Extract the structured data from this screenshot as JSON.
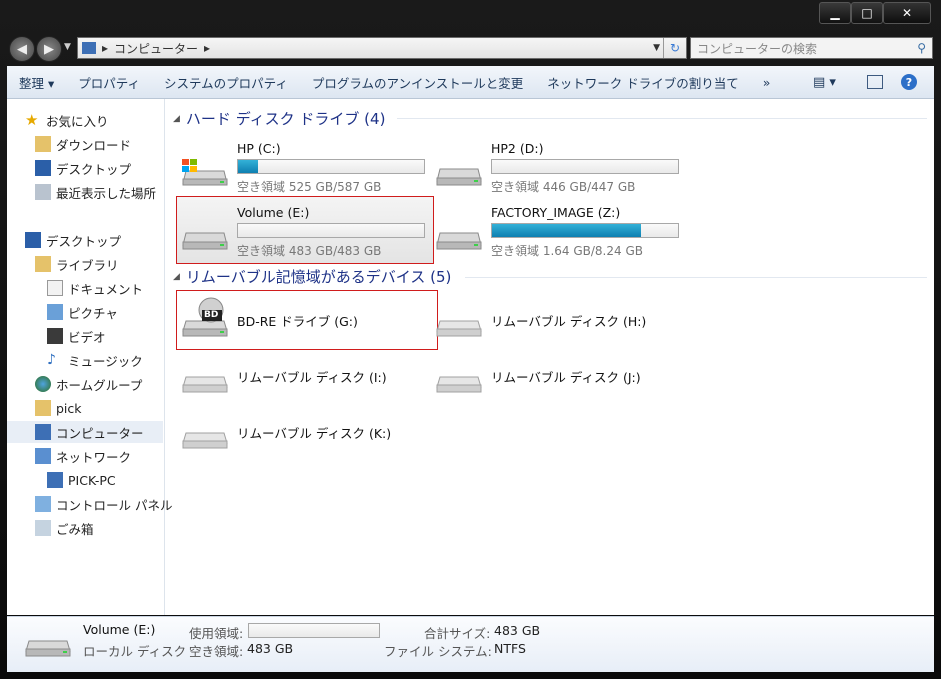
{
  "window": {
    "caption_buttons": [
      "minimize",
      "maximize",
      "close"
    ]
  },
  "address": {
    "path": "コンピューター",
    "search_placeholder": "コンピューターの検索"
  },
  "toolbar": {
    "organize": "整理 ▾",
    "properties": "プロパティ",
    "system_properties": "システムのプロパティ",
    "uninstall": "プログラムのアンインストールと変更",
    "map_drive": "ネットワーク ドライブの割り当て",
    "more": "»"
  },
  "nav": {
    "favorites": "お気に入り",
    "downloads": "ダウンロード",
    "desktop_fav": "デスクトップ",
    "recent": "最近表示した場所",
    "desktop": "デスクトップ",
    "libraries": "ライブラリ",
    "documents": "ドキュメント",
    "pictures": "ピクチャ",
    "videos": "ビデオ",
    "music": "ミュージック",
    "homegroup": "ホームグループ",
    "user": "pick",
    "computer": "コンピューター",
    "network": "ネットワーク",
    "pc": "PICK-PC",
    "control_panel": "コントロール パネル",
    "recycle": "ごみ箱"
  },
  "groups": {
    "hdd": "ハード ディスク ドライブ (4)",
    "removable": "リムーバブル記憶域があるデバイス (5)"
  },
  "drives": {
    "c": {
      "name": "HP (C:)",
      "free": "空き領域 525 GB/587 GB",
      "used_fraction": 0.106
    },
    "d": {
      "name": "HP2 (D:)",
      "free": "空き領域 446 GB/447 GB",
      "used_fraction": 0.002
    },
    "e": {
      "name": "Volume (E:)",
      "free": "空き領域 483 GB/483 GB",
      "used_fraction": 0.0
    },
    "z": {
      "name": "FACTORY_IMAGE (Z:)",
      "free": "空き領域 1.64 GB/8.24 GB",
      "used_fraction": 0.8
    },
    "g": {
      "name": "BD-RE ドライブ (G:)",
      "badge": "BD"
    },
    "h": {
      "name": "リムーバブル ディスク (H:)"
    },
    "i": {
      "name": "リムーバブル ディスク (I:)"
    },
    "j": {
      "name": "リムーバブル ディスク (J:)"
    },
    "k": {
      "name": "リムーバブル ディスク (K:)"
    }
  },
  "status": {
    "name": "Volume (E:)",
    "type": "ローカル ディスク",
    "used_label": "使用領域:",
    "free_label": "空き領域:",
    "free_value": "483 GB",
    "total_label": "合計サイズ:",
    "total_value": "483 GB",
    "fs_label": "ファイル システム:",
    "fs_value": "NTFS",
    "used_fraction": 0.0
  }
}
